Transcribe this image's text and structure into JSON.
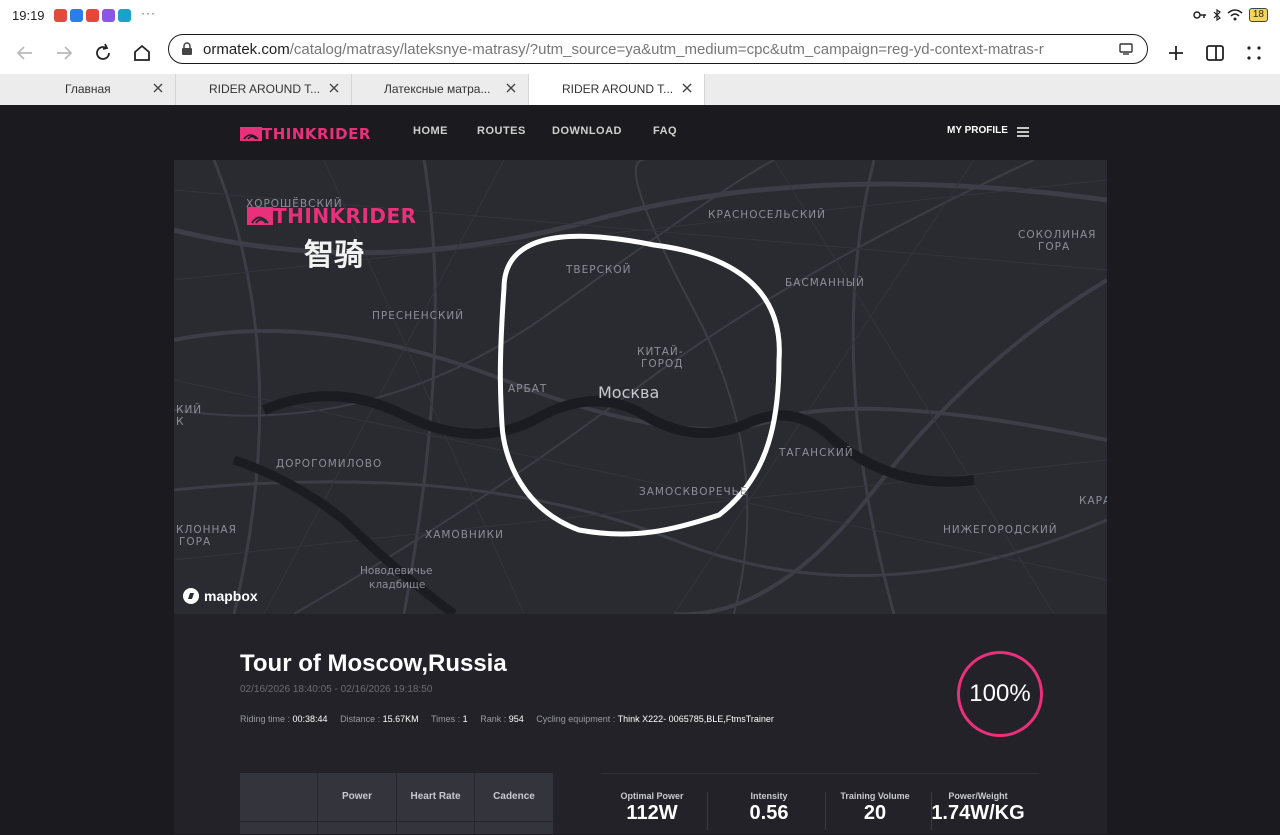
{
  "status": {
    "time": "19:19",
    "more": "···",
    "battery": "18"
  },
  "browser": {
    "url_domain": "ormatek.com",
    "url_path": "/catalog/matrasy/lateksnye-matrasy/?utm_source=ya&utm_medium=cpc&utm_campaign=reg-yd-context-matras-r",
    "tabs": [
      {
        "title": "Главная"
      },
      {
        "title": "RIDER AROUND T..."
      },
      {
        "title": "Латексные матра..."
      },
      {
        "title": "RIDER AROUND T..."
      }
    ]
  },
  "site": {
    "logo": "THINKRIDER",
    "nav": [
      "HOME",
      "ROUTES",
      "DOWNLOAD",
      "FAQ"
    ],
    "profile": "MY PROFILE"
  },
  "map": {
    "logo_text": "THINKRIDER",
    "logo_cn": "智骑",
    "city": "Москва",
    "labels": [
      "ХОРОШЁВСКИЙ",
      "КРАСНОСЕЛЬСКИЙ",
      "СОКОЛИНАЯ",
      "ГОРА",
      "ТВЕРСКОЙ",
      "БАСМАННЫЙ",
      "ПРЕСНЕНСКИЙ",
      "КИТАЙ-",
      "ГОРОД",
      "АРБАТ",
      "КИЙ",
      "К",
      "ТАГАНСКИЙ",
      "ДОРОГОМИЛОВО",
      "ЗАМОСКВОРЕЧЬЕ",
      "КАРА",
      "КЛОННАЯ",
      "ГОРА",
      "ХАМОВНИКИ",
      "НИЖЕГОРОДСКИЙ",
      "Новодевичье",
      "кладбище"
    ],
    "attribution": "mapbox"
  },
  "tour": {
    "title": "Tour of Moscow,Russia",
    "dates": "02/16/2026 18:40:05 - 02/16/2026 19:18:50",
    "riding_time_label": "Riding time : ",
    "riding_time": "00:38:44",
    "distance_label": "Distance : ",
    "distance": "15.67KM",
    "times_label": "Times : ",
    "times": "1",
    "rank_label": "Rank : ",
    "rank": "954",
    "equipment_label": "Cycling equipment : ",
    "equipment": "Think X222- 0065785,BLE,FtmsTrainer",
    "completion": "100%"
  },
  "table": {
    "headers": [
      "",
      "Power",
      "Heart Rate",
      "Cadence"
    ]
  },
  "metrics": [
    {
      "label": "Optimal Power",
      "value": "112W"
    },
    {
      "label": "Intensity",
      "value": "0.56"
    },
    {
      "label": "Training Volume",
      "value": "20"
    },
    {
      "label": "Power/Weight",
      "value": "1.74W/KG"
    }
  ],
  "colors": {
    "accent": "#e8317a",
    "background": "#1b1b1f",
    "map": "#2a2a31"
  }
}
